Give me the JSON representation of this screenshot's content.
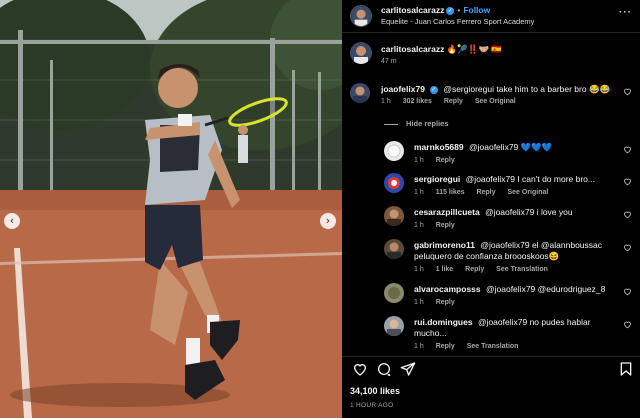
{
  "post": {
    "username": "carlitosalcarazz",
    "verified_glyph": "✓",
    "separator": "•",
    "follow_label": "Follow",
    "location": "Equelite - Juan Carlos Ferrero Sport Academy",
    "more_label": "···"
  },
  "media": {
    "prev_label": "‹",
    "next_label": "›"
  },
  "caption": {
    "username": "carlitosalcarazz",
    "text": "🔥🎾‼️🤝🏼 🇪🇸",
    "time": "47 m"
  },
  "comments": [
    {
      "username": "joaofelix79",
      "verified": true,
      "text": "@sergioregui take him to a barber bro 😂😂",
      "time": "1 h",
      "likes": "302 likes",
      "reply_label": "Reply",
      "see_original_label": "See Original",
      "avatar_color": "#3b4a6b"
    }
  ],
  "hide_replies_label": "Hide replies",
  "replies": [
    {
      "username": "marnko5689",
      "text": "@joaofelix79 💙💙💙",
      "time": "1 h",
      "reply_label": "Reply",
      "avatar_color": "#e8e8e8"
    },
    {
      "username": "sergioregui",
      "text": "@joaofelix79 I can't do more bro...",
      "time": "1 h",
      "likes": "115 likes",
      "reply_label": "Reply",
      "see_original_label": "See Original",
      "avatar_color": "#2d4aa8"
    },
    {
      "username": "cesarazpillcueta",
      "text": "@joaofelix79 i love you",
      "time": "1 h",
      "reply_label": "Reply",
      "avatar_color": "#7a5a3c"
    },
    {
      "username": "gabrimoreno11",
      "text": "@joaofelix79 el @alannboussac peluquero de confianza broooskoos😆",
      "time": "1 h",
      "likes": "1 like",
      "reply_label": "Reply",
      "see_translation_label": "See Translation",
      "avatar_color": "#5a4a3a"
    },
    {
      "username": "alvarocamposss",
      "text": "@joaofelix79 @edurodriguez_8",
      "time": "1 h",
      "reply_label": "Reply",
      "avatar_color": "#8a8a6a"
    },
    {
      "username": "rui.domingues",
      "text": "@joaofelix79 no pudes hablar mucho...",
      "time": "1 h",
      "reply_label": "Reply",
      "see_translation_label": "See Translation",
      "avatar_color": "#9aa0a8"
    }
  ],
  "footer": {
    "likes": "34,100 likes",
    "posted": "1 HOUR AGO"
  },
  "icons": {
    "heart": "heart-icon",
    "comment": "comment-icon",
    "share": "share-icon",
    "save": "bookmark-icon"
  },
  "colors": {
    "accent_blue": "#4aa3f5",
    "verified_blue": "#3797f0",
    "muted_text": "#a8a8a8",
    "clay": "#b86a48"
  }
}
